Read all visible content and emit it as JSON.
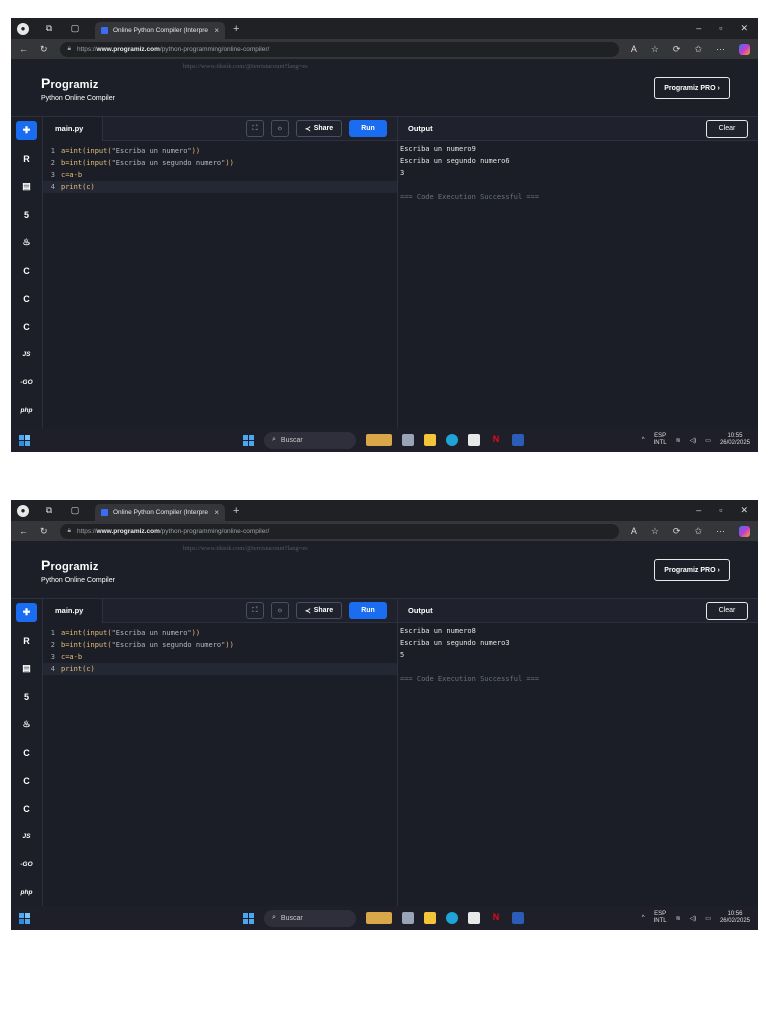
{
  "screens": [
    {
      "browser": {
        "tab_title": "Online Python Compiler (Interpre",
        "tab_close": "×",
        "new_tab": "+",
        "url_prefix": "https://",
        "url_domain": "www.programiz.com",
        "url_path": "/python-programming/online-compiler/"
      },
      "header": {
        "logo_initial": "P",
        "logo_rest": "rogramiz",
        "subtitle": "Python Online Compiler",
        "watermark": "https://www.tiktok.com/@terristacount?lang=es",
        "pro_button": "Programiz PRO ›"
      },
      "editor": {
        "file_tab": "main.py",
        "share_label": "Share",
        "run_label": "Run",
        "lines": [
          {
            "n": "1",
            "fn": "a=int(input(",
            "str": "\"Escriba un numero\"",
            "end": "))"
          },
          {
            "n": "2",
            "fn": "b=int(input(",
            "str": "\"Escriba un segundo numero\"",
            "end": "))"
          },
          {
            "n": "3",
            "fn": "c=a-b",
            "str": "",
            "end": ""
          },
          {
            "n": "4",
            "fn": "print(c)",
            "str": "",
            "end": ""
          }
        ]
      },
      "output": {
        "title": "Output",
        "clear_label": "Clear",
        "lines": [
          "Escriba un numero9",
          "Escriba un segundo numero6",
          "3"
        ],
        "status": "=== Code Execution Successful ==="
      },
      "taskbar": {
        "search_label": "Buscar",
        "lang_top": "ESP",
        "lang_bottom": "INTL",
        "time": "10:55",
        "date": "26/02/2025"
      }
    },
    {
      "browser": {
        "tab_title": "Online Python Compiler (Interpre",
        "tab_close": "×",
        "new_tab": "+",
        "url_prefix": "https://",
        "url_domain": "www.programiz.com",
        "url_path": "/python-programming/online-compiler/"
      },
      "header": {
        "logo_initial": "P",
        "logo_rest": "rogramiz",
        "subtitle": "Python Online Compiler",
        "watermark": "https://www.tiktok.com/@terristacount?lang=es",
        "pro_button": "Programiz PRO ›"
      },
      "editor": {
        "file_tab": "main.py",
        "share_label": "Share",
        "run_label": "Run",
        "lines": [
          {
            "n": "1",
            "fn": "a=int(input(",
            "str": "\"Escriba un numero\"",
            "end": "))"
          },
          {
            "n": "2",
            "fn": "b=int(input(",
            "str": "\"Escriba un segundo numero\"",
            "end": "))"
          },
          {
            "n": "3",
            "fn": "c=a-b",
            "str": "",
            "end": ""
          },
          {
            "n": "4",
            "fn": "print(c)",
            "str": "",
            "end": ""
          }
        ]
      },
      "output": {
        "title": "Output",
        "clear_label": "Clear",
        "lines": [
          "Escriba un numero8",
          "Escriba un segundo numero3",
          "5"
        ],
        "status": "=== Code Execution Successful ==="
      },
      "taskbar": {
        "search_label": "Buscar",
        "lang_top": "ESP",
        "lang_bottom": "INTL",
        "time": "10:56",
        "date": "26/02/2025"
      }
    }
  ],
  "languages": [
    {
      "icon": "python-icon",
      "glyph": "✚"
    },
    {
      "icon": "r-icon",
      "glyph": "R"
    },
    {
      "icon": "sql-icon",
      "glyph": "▤"
    },
    {
      "icon": "html-icon",
      "glyph": "5"
    },
    {
      "icon": "java-icon",
      "glyph": "♨"
    },
    {
      "icon": "c-icon",
      "glyph": "C"
    },
    {
      "icon": "cpp-icon",
      "glyph": "C"
    },
    {
      "icon": "csharp-icon",
      "glyph": "C"
    },
    {
      "icon": "js-icon",
      "glyph": "JS"
    },
    {
      "icon": "go-icon",
      "glyph": "-GO"
    },
    {
      "icon": "php-icon",
      "glyph": "php"
    }
  ],
  "colors": {
    "accent": "#1a6cf0",
    "panel": "#1b1e27",
    "header": "#1c1f28"
  }
}
